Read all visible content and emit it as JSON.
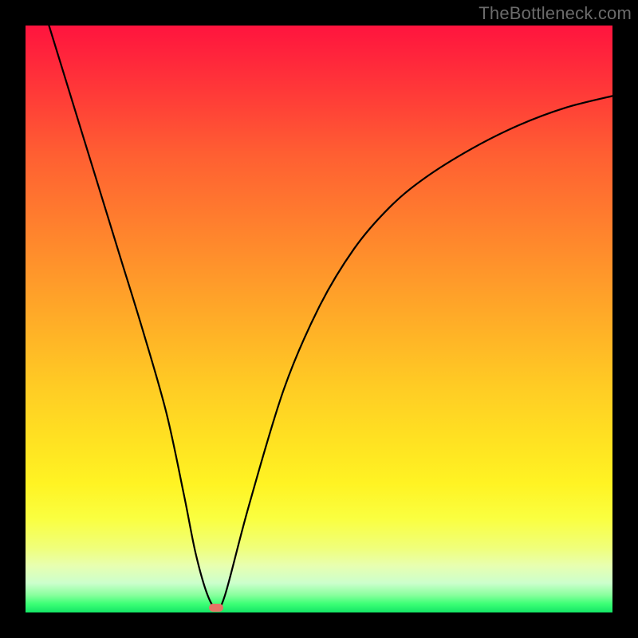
{
  "watermark": "TheBottleneck.com",
  "colors": {
    "frame": "#000000",
    "curve": "#000000",
    "marker": "#e57366"
  },
  "chart_data": {
    "type": "line",
    "title": "",
    "xlabel": "",
    "ylabel": "",
    "xlim": [
      0,
      100
    ],
    "ylim": [
      0,
      100
    ],
    "grid": false,
    "legend": false,
    "series": [
      {
        "name": "bottleneck-curve",
        "x": [
          4,
          8,
          12,
          16,
          20,
          24,
          27,
          29,
          31,
          32.5,
          34,
          38,
          44,
          50,
          56,
          62,
          68,
          76,
          84,
          92,
          100
        ],
        "y": [
          100,
          87,
          74,
          61,
          48,
          34,
          20,
          10,
          3,
          0.8,
          3,
          18,
          38,
          52,
          62,
          69,
          74,
          79,
          83,
          86,
          88
        ]
      }
    ],
    "annotations": [
      {
        "name": "minimum-point",
        "x": 32.5,
        "y": 0.8
      }
    ]
  }
}
